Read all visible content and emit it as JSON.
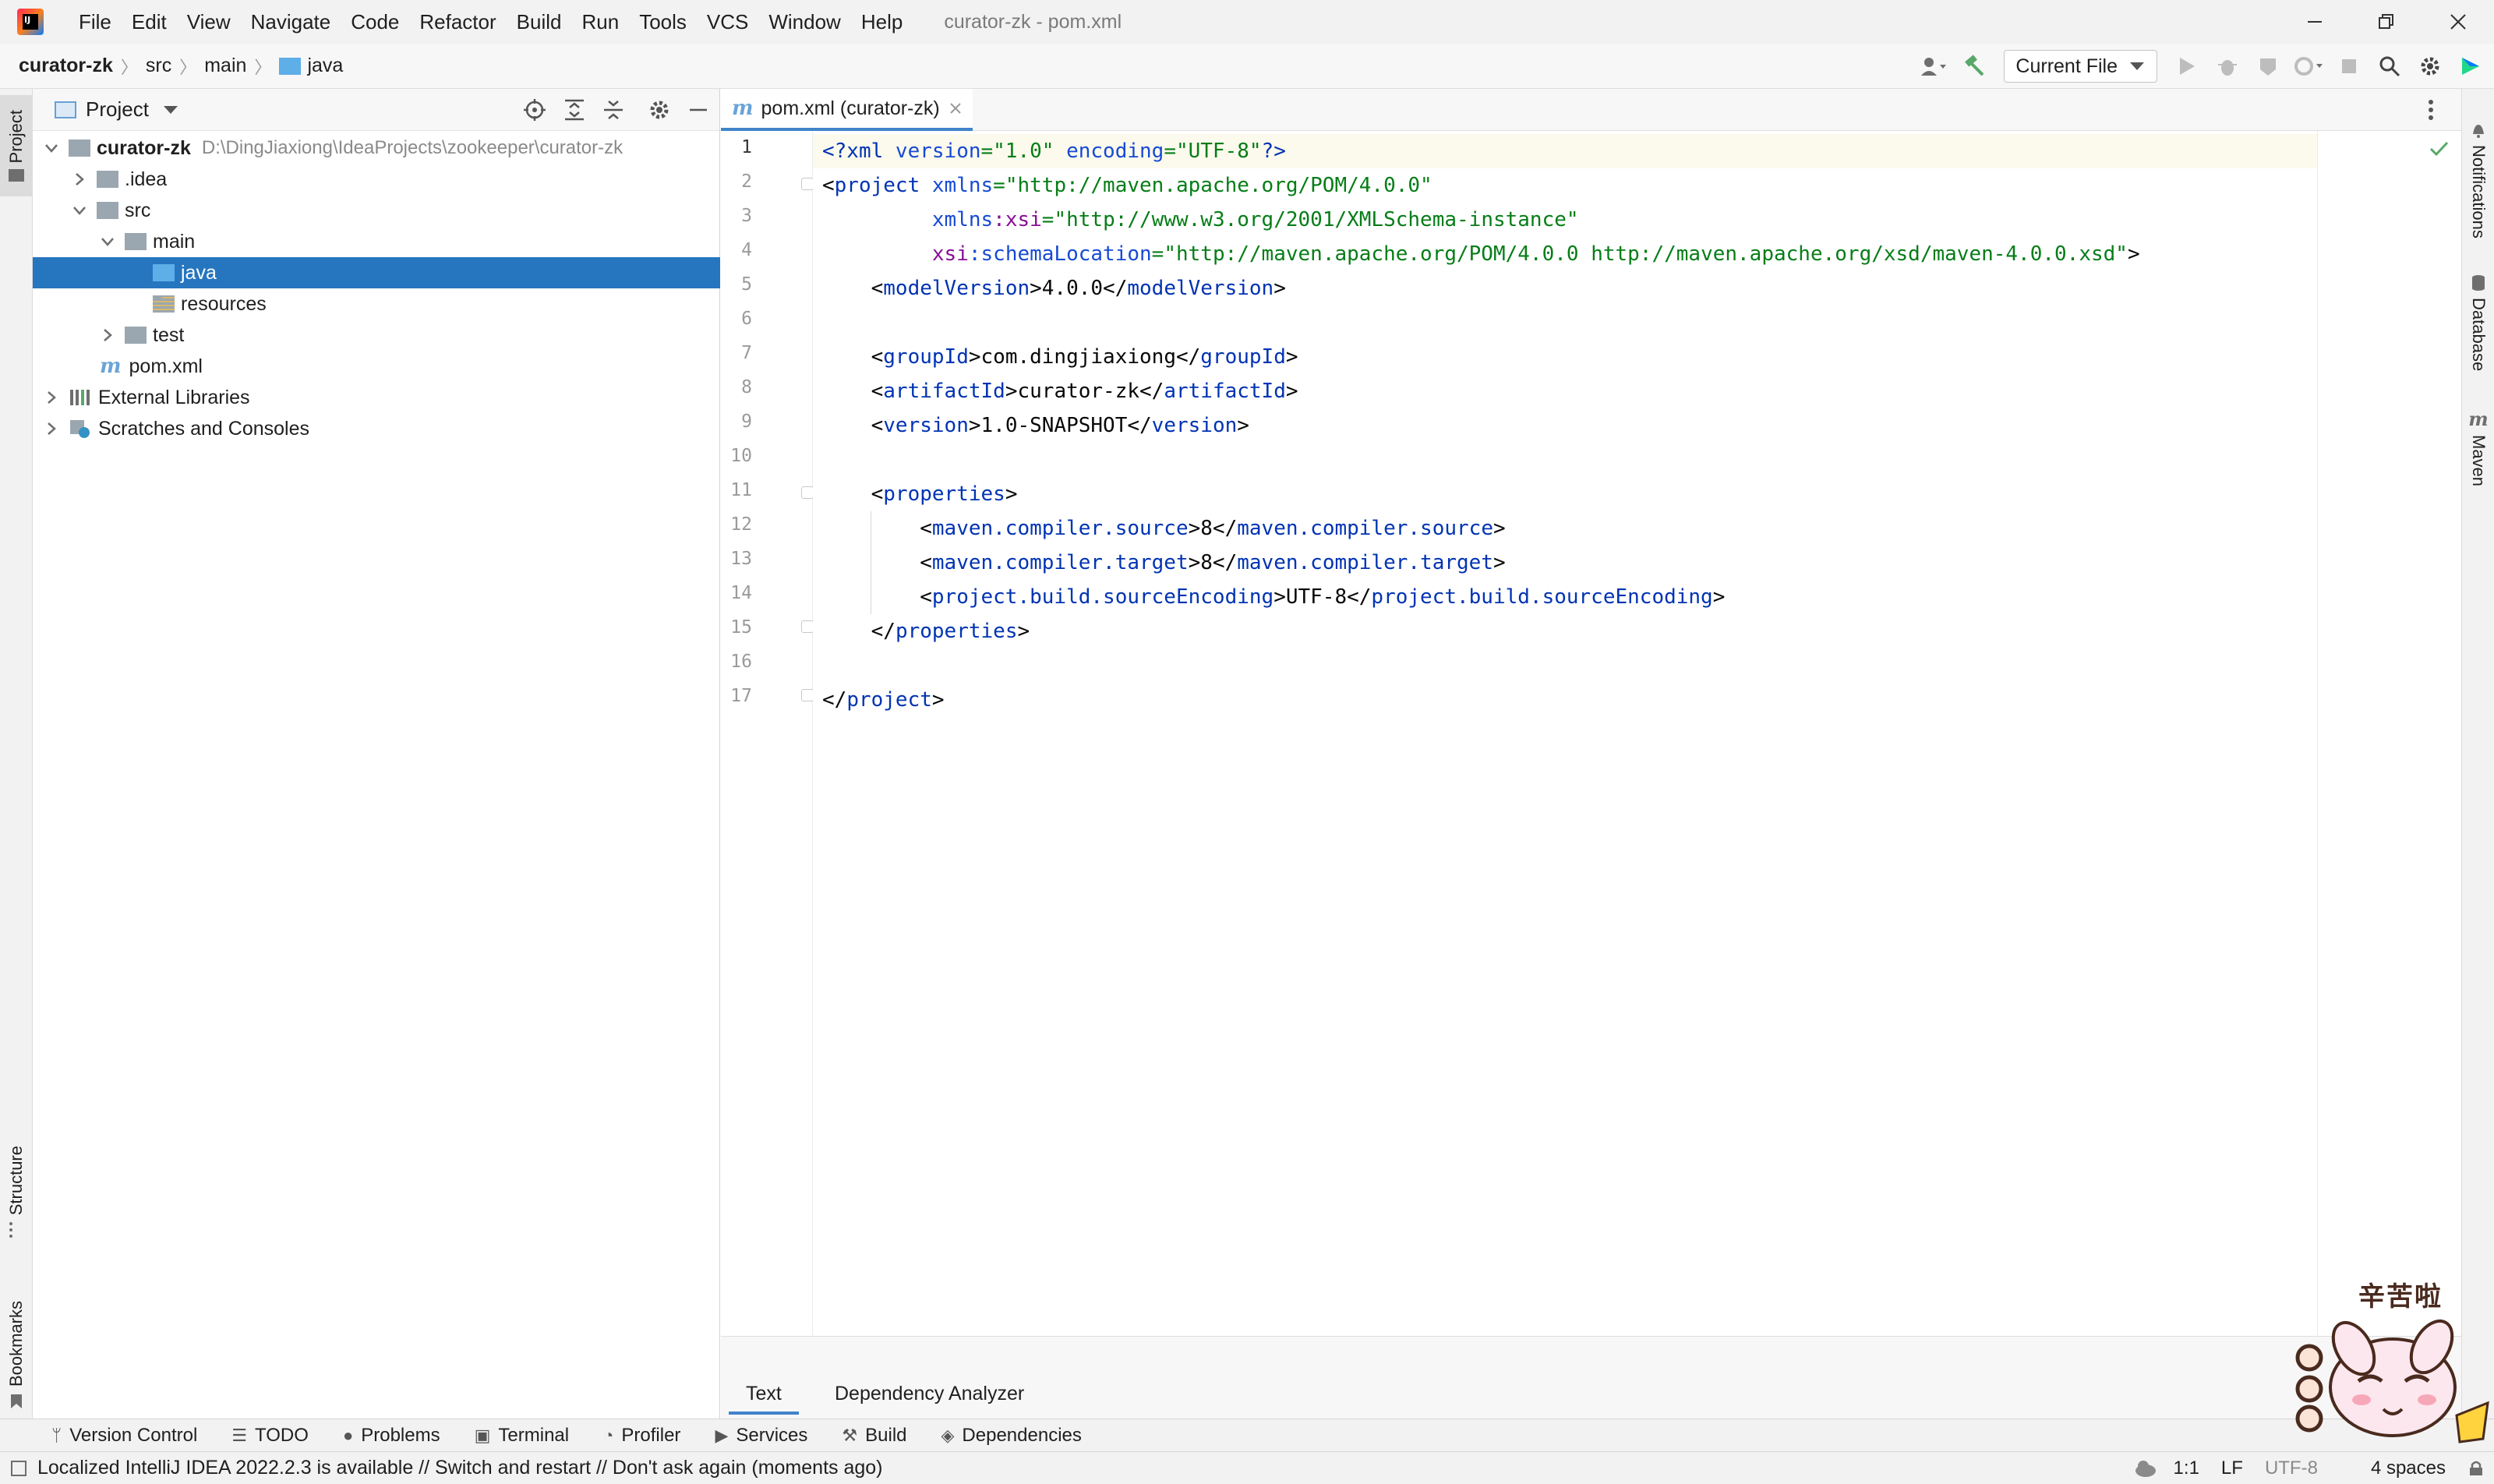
{
  "menu": {
    "items": [
      "File",
      "Edit",
      "View",
      "Navigate",
      "Code",
      "Refactor",
      "Build",
      "Run",
      "Tools",
      "VCS",
      "Window",
      "Help"
    ],
    "window_title": "curator-zk - pom.xml"
  },
  "breadcrumb": [
    "curator-zk",
    "src",
    "main",
    "java"
  ],
  "toolbar": {
    "run_config": "Current File"
  },
  "left_stripe": {
    "project_tab": "Project",
    "structure_tab": "Structure",
    "bookmarks_tab": "Bookmarks"
  },
  "right_stripe": {
    "notifications_tab": "Notifications",
    "database_tab": "Database",
    "maven_tab": "Maven"
  },
  "project_panel": {
    "title": "Project",
    "tree": [
      {
        "label": "curator-zk",
        "path": "D:\\DingJiaxiong\\IdeaProjects\\zookeeper\\curator-zk"
      },
      {
        "label": ".idea"
      },
      {
        "label": "src"
      },
      {
        "label": "main"
      },
      {
        "label": "java"
      },
      {
        "label": "resources"
      },
      {
        "label": "test"
      },
      {
        "label": "pom.xml"
      },
      {
        "label": "External Libraries"
      },
      {
        "label": "Scratches and Consoles"
      }
    ]
  },
  "editor": {
    "tab_label": "pom.xml (curator-zk)",
    "line_numbers": [
      "1",
      "2",
      "3",
      "4",
      "5",
      "6",
      "7",
      "8",
      "9",
      "10",
      "11",
      "12",
      "13",
      "14",
      "15",
      "16",
      "17"
    ],
    "bottom_tabs": [
      "Text",
      "Dependency Analyzer"
    ]
  },
  "tool_windows": [
    "Version Control",
    "TODO",
    "Problems",
    "Terminal",
    "Profiler",
    "Services",
    "Build",
    "Dependencies"
  ],
  "status": {
    "message": "Localized IntelliJ IDEA 2022.2.3 is available // Switch and restart // Don't ask again (moments ago)",
    "position": "1:1",
    "line_sep": "LF",
    "encoding": "UTF-8",
    "indent": "4 spaces"
  },
  "sticker": {
    "text": "辛苦啦"
  }
}
